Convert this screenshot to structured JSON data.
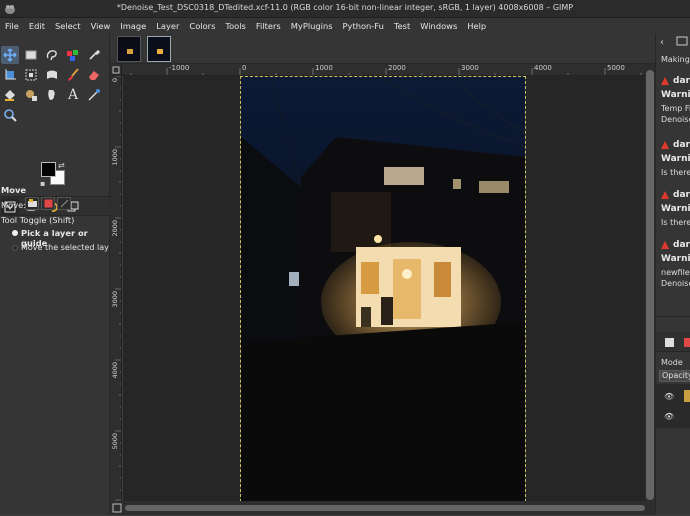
{
  "window": {
    "title": "*Denoise_Test_DSC0318_DTedited.xcf-11.0 (RGB color 16-bit non-linear integer, sRGB, 1 layer) 4008x6008 – GIMP"
  },
  "menubar": [
    "File",
    "Edit",
    "Select",
    "View",
    "Image",
    "Layer",
    "Colors",
    "Tools",
    "Filters",
    "MyPlugins",
    "Python-Fu",
    "Test",
    "Windows",
    "Help"
  ],
  "colors": {
    "accent_selected": "#4d5e73",
    "warning": "#e03a2f",
    "canvas_bg": "#262626",
    "selection_border": "#c8c060"
  },
  "toolbox": {
    "tools": [
      {
        "name": "move-tool-icon",
        "selected": true
      },
      {
        "name": "rect-select-icon"
      },
      {
        "name": "free-select-icon"
      },
      {
        "name": "fuzzy-select-icon"
      },
      {
        "name": "color-picker-icon"
      },
      {
        "name": "crop-icon"
      },
      {
        "name": "unified-transform-icon"
      },
      {
        "name": "warp-transform-icon"
      },
      {
        "name": "paintbrush-icon"
      },
      {
        "name": "eraser-icon"
      },
      {
        "name": "bucket-fill-icon"
      },
      {
        "name": "clone-icon"
      },
      {
        "name": "smudge-icon"
      },
      {
        "name": "text-icon"
      },
      {
        "name": "path-icon"
      },
      {
        "name": "zoom-icon"
      }
    ],
    "text_tool_glyph": "A"
  },
  "tool_options": {
    "title": "Move",
    "move_label": "Move:",
    "toggle_label": "Tool Toggle  (Shift)",
    "radio_pick": "Pick a layer or guide",
    "radio_move": "Move the selected layers"
  },
  "rulers": {
    "top": [
      "-1000",
      "0",
      "1000",
      "2000",
      "3000",
      "4000",
      "5000"
    ],
    "left": [
      "0",
      "1000",
      "2000",
      "3000",
      "4000",
      "5000",
      "6000"
    ]
  },
  "right_panel": {
    "top_text": "Making t",
    "messages": [
      {
        "source": "darl",
        "title": "Warnin",
        "lines": [
          "Temp Fil",
          "Denoise_"
        ]
      },
      {
        "source": "darl",
        "title": "Warnin",
        "lines": [
          "Is there"
        ]
      },
      {
        "source": "darl",
        "title": "Warnin",
        "lines": [
          "Is there"
        ]
      },
      {
        "source": "darl",
        "title": "Warnin",
        "lines": [
          "newfileR",
          "Denoise_"
        ]
      }
    ],
    "layers": {
      "mode_label": "Mode",
      "opacity_label": "Opacity"
    }
  }
}
